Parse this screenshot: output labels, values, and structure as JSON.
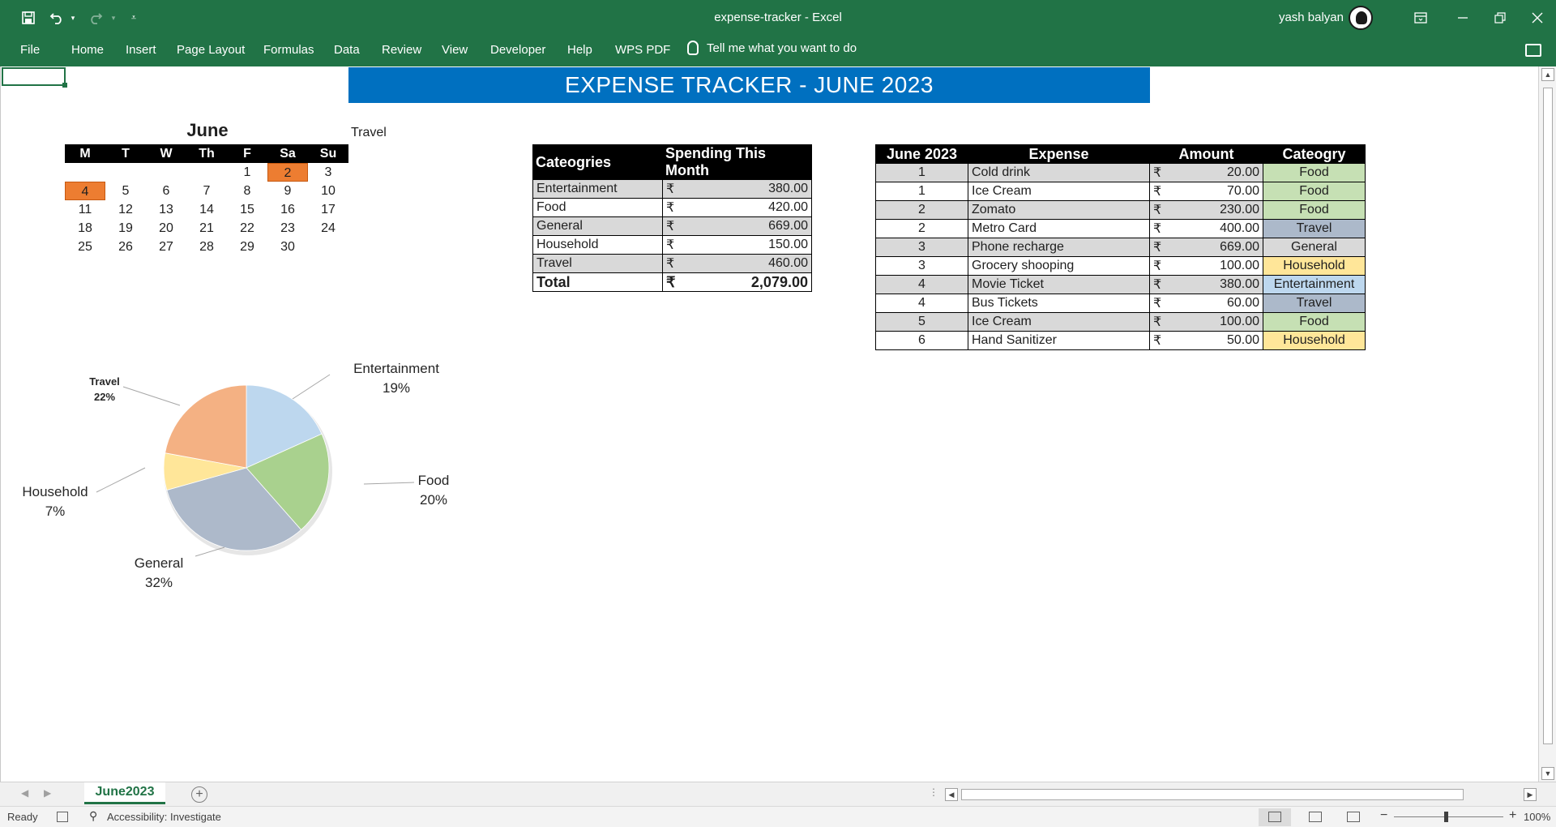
{
  "window": {
    "title": "expense-tracker  -  Excel",
    "user_name": "yash balyan"
  },
  "menu": {
    "file": "File",
    "home": "Home",
    "insert": "Insert",
    "page_layout": "Page Layout",
    "formulas": "Formulas",
    "data": "Data",
    "review": "Review",
    "view": "View",
    "developer": "Developer",
    "help": "Help",
    "wps_pdf": "WPS PDF",
    "tell_me": "Tell me what you want to do"
  },
  "sheet": {
    "banner": "EXPENSE TRACKER - JUNE 2023",
    "travel_label": "Travel",
    "calendar": {
      "month": "June",
      "weekdays": [
        "M",
        "T",
        "W",
        "Th",
        "F",
        "Sa",
        "Su"
      ],
      "leading_blanks": 4,
      "days": [
        "1",
        "2",
        "3",
        "4",
        "5",
        "6",
        "7",
        "8",
        "9",
        "10",
        "11",
        "12",
        "13",
        "14",
        "15",
        "16",
        "17",
        "18",
        "19",
        "20",
        "21",
        "22",
        "23",
        "24",
        "25",
        "26",
        "27",
        "28",
        "29",
        "30"
      ],
      "highlighted": [
        "2",
        "4"
      ],
      "highlight_color": "#ed7d31"
    },
    "category_table": {
      "headers": [
        "Cateogries",
        "Spending This Month"
      ],
      "currency": "₹",
      "rows": [
        {
          "category": "Entertainment",
          "amount": "380.00"
        },
        {
          "category": "Food",
          "amount": "420.00"
        },
        {
          "category": "General",
          "amount": "669.00"
        },
        {
          "category": "Household",
          "amount": "150.00"
        },
        {
          "category": "Travel",
          "amount": "460.00"
        }
      ],
      "total": {
        "label": "Total",
        "amount": "2,079.00"
      }
    },
    "expense_table": {
      "headers": [
        "June 2023",
        "Expense",
        "Amount",
        "Cateogry"
      ],
      "currency": "₹",
      "rows": [
        {
          "day": "1",
          "expense": "Cold drink",
          "amount": "20.00",
          "category": "Food"
        },
        {
          "day": "1",
          "expense": "Ice Cream",
          "amount": "70.00",
          "category": "Food"
        },
        {
          "day": "2",
          "expense": "Zomato",
          "amount": "230.00",
          "category": "Food"
        },
        {
          "day": "2",
          "expense": "Metro Card",
          "amount": "400.00",
          "category": "Travel"
        },
        {
          "day": "3",
          "expense": "Phone recharge",
          "amount": "669.00",
          "category": "General"
        },
        {
          "day": "3",
          "expense": "Grocery shooping",
          "amount": "100.00",
          "category": "Household"
        },
        {
          "day": "4",
          "expense": "Movie Ticket",
          "amount": "380.00",
          "category": "Entertainment"
        },
        {
          "day": "4",
          "expense": "Bus Tickets",
          "amount": "60.00",
          "category": "Travel"
        },
        {
          "day": "5",
          "expense": "Ice Cream",
          "amount": "100.00",
          "category": "Food"
        },
        {
          "day": "6",
          "expense": "Hand Sanitizer",
          "amount": "50.00",
          "category": "Household"
        }
      ],
      "category_colors": {
        "Food": "#c6e0b4",
        "Travel": "#acb9ca",
        "General": "#d9d9d9",
        "Household": "#ffe699",
        "Entertainment": "#bdd7ee"
      }
    }
  },
  "chart_data": {
    "type": "pie",
    "categories": [
      "Entertainment",
      "Food",
      "General",
      "Household",
      "Travel"
    ],
    "values": [
      380,
      420,
      669,
      150,
      460
    ],
    "labels": [
      "19%",
      "20%",
      "32%",
      "7%",
      "22%"
    ],
    "colors": [
      "#bdd7ee",
      "#a9d18e",
      "#adb9ca",
      "#ffe699",
      "#f4b183"
    ],
    "start_angle_deg": 0,
    "direction": "clockwise",
    "legend": "none"
  },
  "tabs": {
    "sheet_name": "June2023",
    "add_label": "+"
  },
  "status": {
    "ready": "Ready",
    "accessibility": "Accessibility: Investigate",
    "zoom": "100%"
  }
}
